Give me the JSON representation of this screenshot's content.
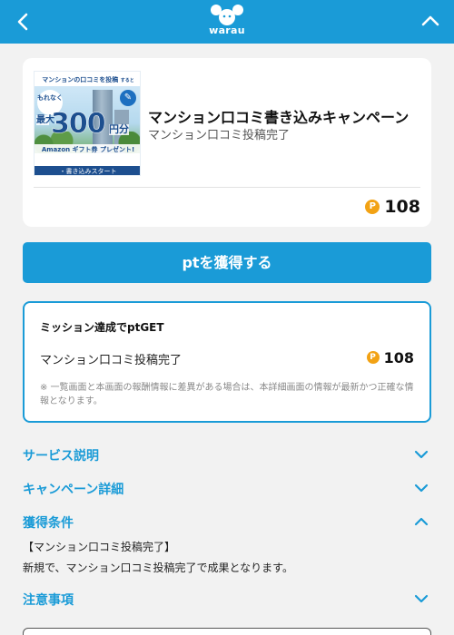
{
  "header": {
    "logo_text": "warau",
    "back_icon": "chevron-left-icon",
    "collapse_icon": "chevron-up-icon",
    "background": "#1a9bd7"
  },
  "campaign": {
    "banner": {
      "top_line": "マンションの口コミを投稿",
      "top_line_suffix": "すると",
      "circle_text": "もれなく",
      "big_prefix": "最大",
      "big_number": "300",
      "big_unit": "円分",
      "gift_line": "Amazon ギフト券 プレゼント!",
      "bottom_label": "・書き込みスタート"
    },
    "title": "マンション口コミ書き込みキャンペーン",
    "subtitle": "マンション口コミ投稿完了",
    "points": "108",
    "point_icon": "P"
  },
  "cta": {
    "label": "ptを獲得する"
  },
  "mission": {
    "title": "ミッション達成でptGET",
    "name": "マンション口コミ投稿完了",
    "points": "108",
    "point_icon": "P",
    "note": "※ 一覧画面と本画面の報酬情報に差異がある場合は、本詳細画面の情報が最新かつ正確な情報となります。"
  },
  "sections": [
    {
      "label": "サービス説明",
      "state": "collapsed"
    },
    {
      "label": "キャンペーン詳細",
      "state": "collapsed"
    },
    {
      "label": "獲得条件",
      "state": "expanded",
      "body": [
        "【マンション口コミ投稿完了】",
        "新規で、マンション口コミ投稿完了で成果となります。"
      ]
    },
    {
      "label": "注意事項",
      "state": "collapsed"
    }
  ],
  "colors": {
    "accent": "#1a9bd7",
    "coin": "#f2a214",
    "banner_blue": "#1d4f8f"
  }
}
